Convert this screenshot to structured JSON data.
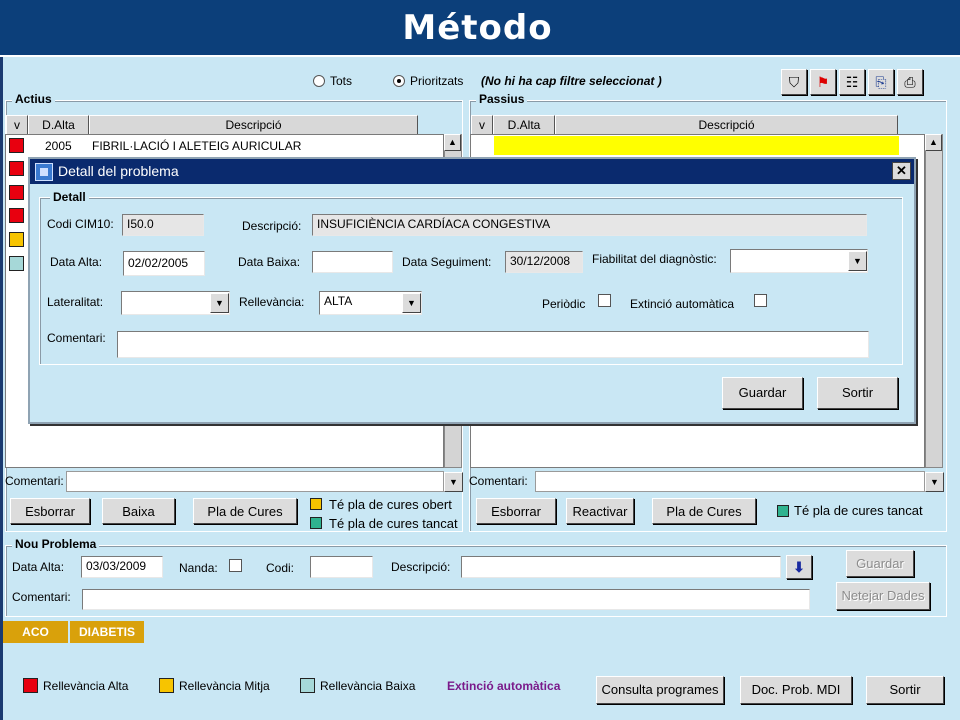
{
  "banner": {
    "title": "Método"
  },
  "filter": {
    "option_all": "Tots",
    "option_prioritized": "Prioritzats",
    "status": "(No hi ha cap filtre seleccionat )"
  },
  "toolbar": {
    "icons": [
      "filter-icon",
      "flag-page-icon",
      "tree-list-icon",
      "export-doc-icon",
      "print-icon"
    ]
  },
  "actius": {
    "title": "Actius",
    "columns": [
      "v",
      "D.Alta",
      "Descripció"
    ],
    "rows": [
      {
        "date": "2005",
        "desc": "FIBRIL·LACIÓ I ALETEIG AURICULAR",
        "color": "#e8000f"
      }
    ],
    "row_markers": [
      "#e8000f",
      "#e8000f",
      "#e8000f",
      "#e8000f",
      "#f7c400",
      "#a6d8d8"
    ],
    "comment_label": "Comentari:",
    "buttons": {
      "delete": "Esborrar",
      "discharge": "Baixa",
      "care_plan": "Pla de Cures"
    },
    "legend_open": "Té pla de cures obert",
    "legend_closed": "Té pla de cures tancat"
  },
  "passius": {
    "title": "Passius",
    "columns": [
      "v",
      "D.Alta",
      "Descripció"
    ],
    "comment_label": "Comentari:",
    "buttons": {
      "delete": "Esborrar",
      "reactivate": "Reactivar",
      "care_plan": "Pla de Cures"
    },
    "legend_closed": "Té pla de cures tancat"
  },
  "dialog": {
    "title": "Detall del problema",
    "group": "Detall",
    "codi_label": "Codi CIM10:",
    "codi_value": "I50.0",
    "desc_label": "Descripció:",
    "desc_value": "INSUFICIÈNCIA CARDÍACA CONGESTIVA",
    "alta_label": "Data  Alta:",
    "alta_value": "02/02/2005",
    "baixa_label": "Data Baixa:",
    "baixa_value": "",
    "seguiment_label": "Data Seguiment:",
    "seguiment_value": "30/12/2008",
    "fiabilitat_label": "Fiabilitat del diagnòstic:",
    "fiabilitat_value": "",
    "lateralitat_label": "Lateralitat:",
    "lateralitat_value": "",
    "rellevancia_label": "Rellevància:",
    "rellevancia_value": "ALTA",
    "periodic_label": "Periòdic",
    "extincio_label": "Extinció automàtica",
    "comentari_label": "Comentari:",
    "comentari_value": "",
    "save": "Guardar",
    "exit": "Sortir"
  },
  "nou": {
    "title": "Nou Problema",
    "alta_label": "Data  Alta:",
    "alta_value": "03/03/2009",
    "nanda_label": "Nanda:",
    "codi_label": "Codi:",
    "codi_value": "",
    "desc_label": "Descripció:",
    "desc_value": "",
    "comment_label": "Comentari:",
    "comment_value": "",
    "save": "Guardar",
    "clear": "Netejar Dades"
  },
  "tags": [
    "ACO",
    "DIABETIS"
  ],
  "legend": {
    "high": "Rellevància Alta",
    "mid": "Rellevància Mitja",
    "low": "Rellevància Baixa",
    "auto": "Extinció automàtica",
    "colors": {
      "high": "#e8000f",
      "mid": "#f7c400",
      "low": "#a6d8d8",
      "auto": "#7a1a8a",
      "tag": "#d9a10b",
      "row_highlight": "#ffff00",
      "closed_plan": "#2fb38f"
    }
  },
  "footer_buttons": {
    "programs": "Consulta programes",
    "doc": "Doc. Prob. MDI",
    "exit": "Sortir"
  }
}
